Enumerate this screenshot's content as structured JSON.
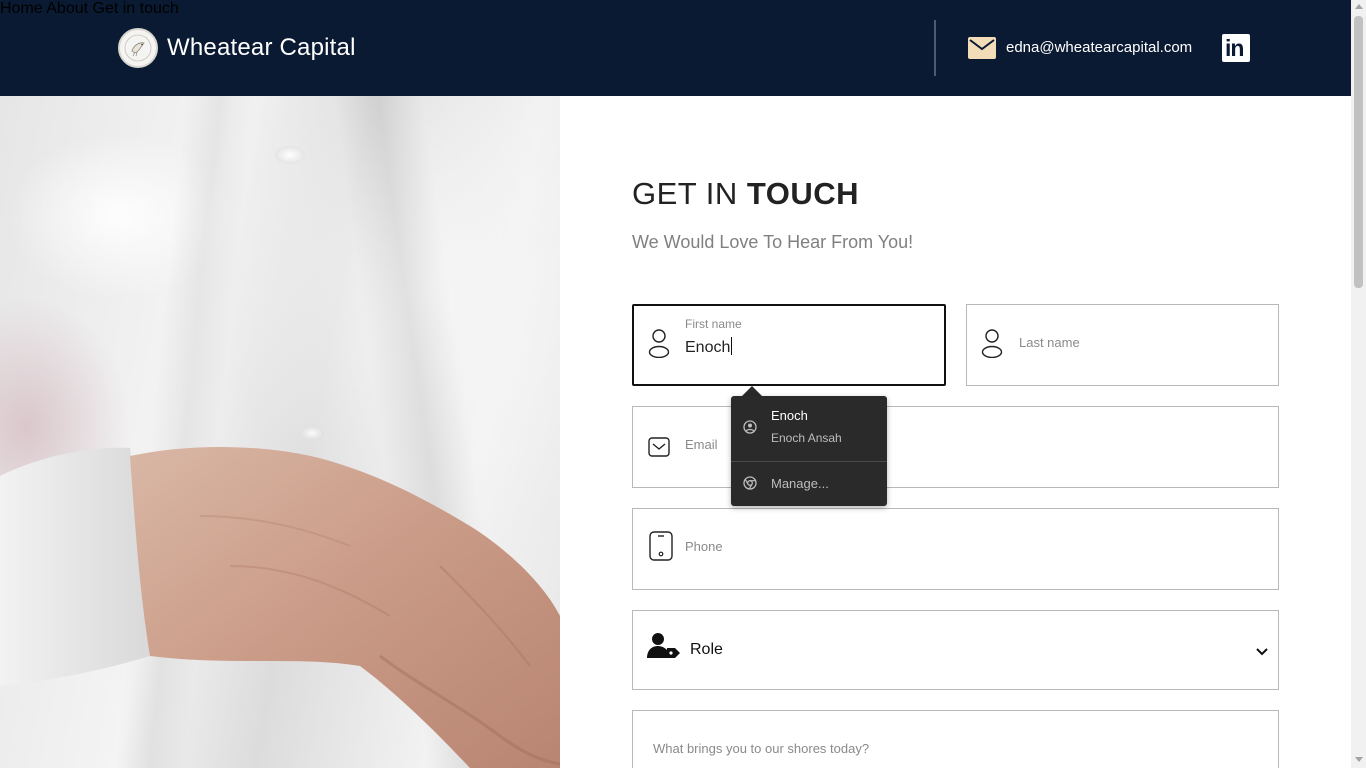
{
  "header": {
    "brand": "Wheatear Capital",
    "nav": [
      {
        "label": "Home"
      },
      {
        "label": "About"
      },
      {
        "label": "Get in touch"
      }
    ],
    "email": "edna@wheatearcapital.com",
    "linkedin_label": "in",
    "background_color": "#0b1a33"
  },
  "form": {
    "title_light": "GET IN ",
    "title_bold": "TOUCH",
    "subtitle": "We Would Love To Hear From You!",
    "first_name": {
      "label": "First name",
      "value": "Enoch",
      "icon": "person-icon"
    },
    "last_name": {
      "placeholder": "Last name",
      "icon": "person-icon"
    },
    "email": {
      "placeholder": "Email",
      "icon": "envelope-icon"
    },
    "phone": {
      "placeholder": "Phone",
      "icon": "phone-icon"
    },
    "role": {
      "selected": "Role",
      "icon": "user-tag-icon"
    },
    "message": {
      "placeholder": "What brings you to our shores today?"
    }
  },
  "autofill": {
    "suggestion_name": "Enoch",
    "suggestion_full": "Enoch Ansah",
    "manage_label": "Manage..."
  }
}
